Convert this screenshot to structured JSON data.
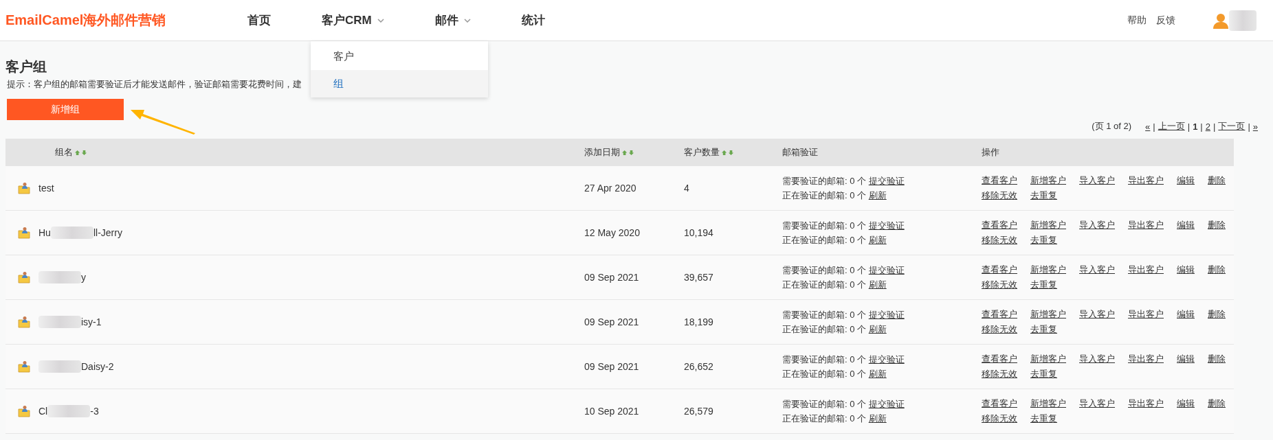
{
  "logo": "EmailCamel海外邮件营销",
  "nav": [
    {
      "label": "首页",
      "has_menu": false
    },
    {
      "label": "客户CRM",
      "has_menu": true
    },
    {
      "label": "邮件",
      "has_menu": true
    },
    {
      "label": "统计",
      "has_menu": false
    }
  ],
  "dropdown": [
    {
      "label": "客户",
      "selected": false
    },
    {
      "label": "组",
      "selected": true
    }
  ],
  "header_links": [
    "帮助",
    "反馈"
  ],
  "page_title": "客户组",
  "hint": "提示：客户组的邮箱需要验证后才能发送邮件，验证邮箱需要花费时间，建",
  "add_button": "新增组",
  "pagination": {
    "summary": "(页 1 of 2)",
    "separator": "|",
    "links": [
      {
        "label": "«",
        "current": false
      },
      {
        "label": "上一页",
        "current": false
      },
      {
        "label": "1",
        "current": true
      },
      {
        "label": "2",
        "current": false
      },
      {
        "label": "下一页",
        "current": false
      },
      {
        "label": "»",
        "current": false
      }
    ]
  },
  "columns": [
    {
      "label": "组名",
      "sortable": true
    },
    {
      "label": "添加日期",
      "sortable": true
    },
    {
      "label": "客户数量",
      "sortable": true
    },
    {
      "label": "邮箱验证",
      "sortable": false
    },
    {
      "label": "操作",
      "sortable": false
    }
  ],
  "rows": [
    {
      "name": [
        {
          "kind": "text",
          "text": "test"
        }
      ],
      "date": "27 Apr 2020",
      "count": "4",
      "verify": [
        {
          "text": "需要验证的邮箱: 0 个",
          "link": "提交验证"
        },
        {
          "text": "正在验证的邮箱: 0 个",
          "link": "刷新"
        }
      ],
      "actions": [
        "查看客户",
        "新增客户",
        "导入客户",
        "导出客户",
        "编辑",
        "删除",
        "移除无效",
        "去重复"
      ]
    },
    {
      "name": [
        {
          "kind": "text",
          "text": "Hu"
        },
        {
          "kind": "blur"
        },
        {
          "kind": "text",
          "text": "ll-Jerry"
        }
      ],
      "date": "12 May 2020",
      "count": "10,194",
      "verify": [
        {
          "text": "需要验证的邮箱: 0 个",
          "link": "提交验证"
        },
        {
          "text": "正在验证的邮箱: 0 个",
          "link": "刷新"
        }
      ],
      "actions": [
        "查看客户",
        "新增客户",
        "导入客户",
        "导出客户",
        "编辑",
        "删除",
        "移除无效",
        "去重复"
      ]
    },
    {
      "name": [
        {
          "kind": "blur"
        },
        {
          "kind": "text",
          "text": "y"
        }
      ],
      "date": "09 Sep 2021",
      "count": "39,657",
      "verify": [
        {
          "text": "需要验证的邮箱: 0 个",
          "link": "提交验证"
        },
        {
          "text": "正在验证的邮箱: 0 个",
          "link": "刷新"
        }
      ],
      "actions": [
        "查看客户",
        "新增客户",
        "导入客户",
        "导出客户",
        "编辑",
        "删除",
        "移除无效",
        "去重复"
      ]
    },
    {
      "name": [
        {
          "kind": "blur"
        },
        {
          "kind": "text",
          "text": "isy-1"
        }
      ],
      "date": "09 Sep 2021",
      "count": "18,199",
      "verify": [
        {
          "text": "需要验证的邮箱: 0 个",
          "link": "提交验证"
        },
        {
          "text": "正在验证的邮箱: 0 个",
          "link": "刷新"
        }
      ],
      "actions": [
        "查看客户",
        "新增客户",
        "导入客户",
        "导出客户",
        "编辑",
        "删除",
        "移除无效",
        "去重复"
      ]
    },
    {
      "name": [
        {
          "kind": "blur"
        },
        {
          "kind": "text",
          "text": "Daisy-2"
        }
      ],
      "date": "09 Sep 2021",
      "count": "26,652",
      "verify": [
        {
          "text": "需要验证的邮箱: 0 个",
          "link": "提交验证"
        },
        {
          "text": "正在验证的邮箱: 0 个",
          "link": "刷新"
        }
      ],
      "actions": [
        "查看客户",
        "新增客户",
        "导入客户",
        "导出客户",
        "编辑",
        "删除",
        "移除无效",
        "去重复"
      ]
    },
    {
      "name": [
        {
          "kind": "text",
          "text": "Cl"
        },
        {
          "kind": "blur"
        },
        {
          "kind": "text",
          "text": "-3"
        }
      ],
      "date": "10 Sep 2021",
      "count": "26,579",
      "verify": [
        {
          "text": "需要验证的邮箱: 0 个",
          "link": "提交验证"
        },
        {
          "text": "正在验证的邮箱: 0 个",
          "link": "刷新"
        }
      ],
      "actions": [
        "查看客户",
        "新增客户",
        "导入客户",
        "导出客户",
        "编辑",
        "删除",
        "移除无效",
        "去重复"
      ]
    }
  ]
}
